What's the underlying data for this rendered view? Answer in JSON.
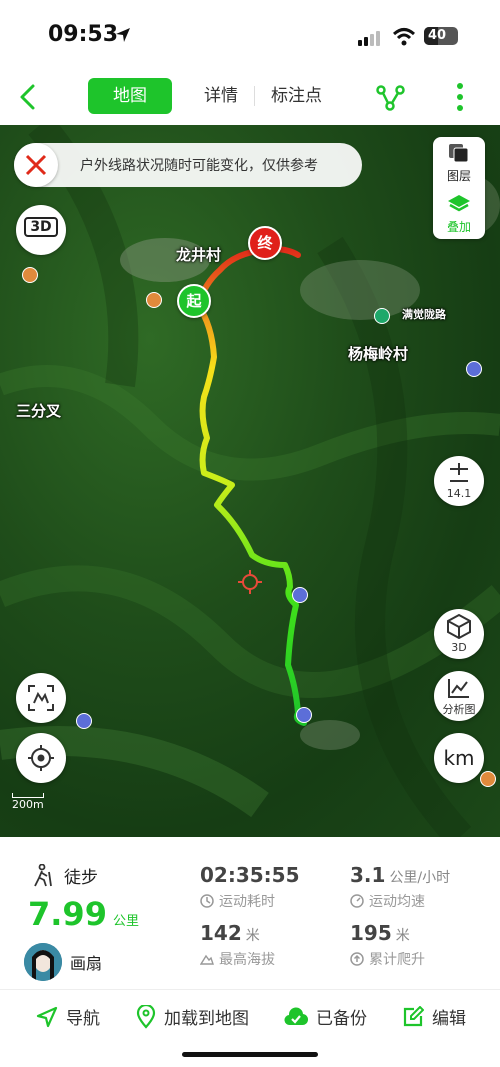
{
  "status_bar": {
    "time": "09:53",
    "battery": "40"
  },
  "nav": {
    "tabs": [
      {
        "label": "地图",
        "active": true
      },
      {
        "label": "详情",
        "active": false
      },
      {
        "label": "标注点",
        "active": false
      }
    ],
    "accent_color": "#1ec42b"
  },
  "map": {
    "notice": "户外线路状况随时可能变化，仅供参考",
    "layers_label": "图层",
    "overlay_label": "叠加",
    "btn_3d_left": "3D",
    "zoom_level": "14.1",
    "btn_3d_right": "3D",
    "analysis_label": "分析图",
    "unit_toggle": "km",
    "scale_label": "200m",
    "places": {
      "longjing": "龙井村",
      "yangmeiling": "杨梅岭村",
      "sanfencha": "三分叉",
      "road": "满觉陇路"
    },
    "start_marker": "起",
    "end_marker": "终"
  },
  "stats": {
    "sport_type": "徒步",
    "distance": "7.99",
    "distance_unit": "公里",
    "user_name": "画扇",
    "duration": "02:35:55",
    "duration_label": "运动耗时",
    "speed": "3.1",
    "speed_unit": "公里/小时",
    "speed_label": "运动均速",
    "max_altitude": "142",
    "max_altitude_unit": "米",
    "max_altitude_label": "最高海拔",
    "climb": "195",
    "climb_unit": "米",
    "climb_label": "累计爬升"
  },
  "actions": {
    "navigate": "导航",
    "load_to_map": "加载到地图",
    "backed_up": "已备份",
    "edit": "编辑"
  }
}
